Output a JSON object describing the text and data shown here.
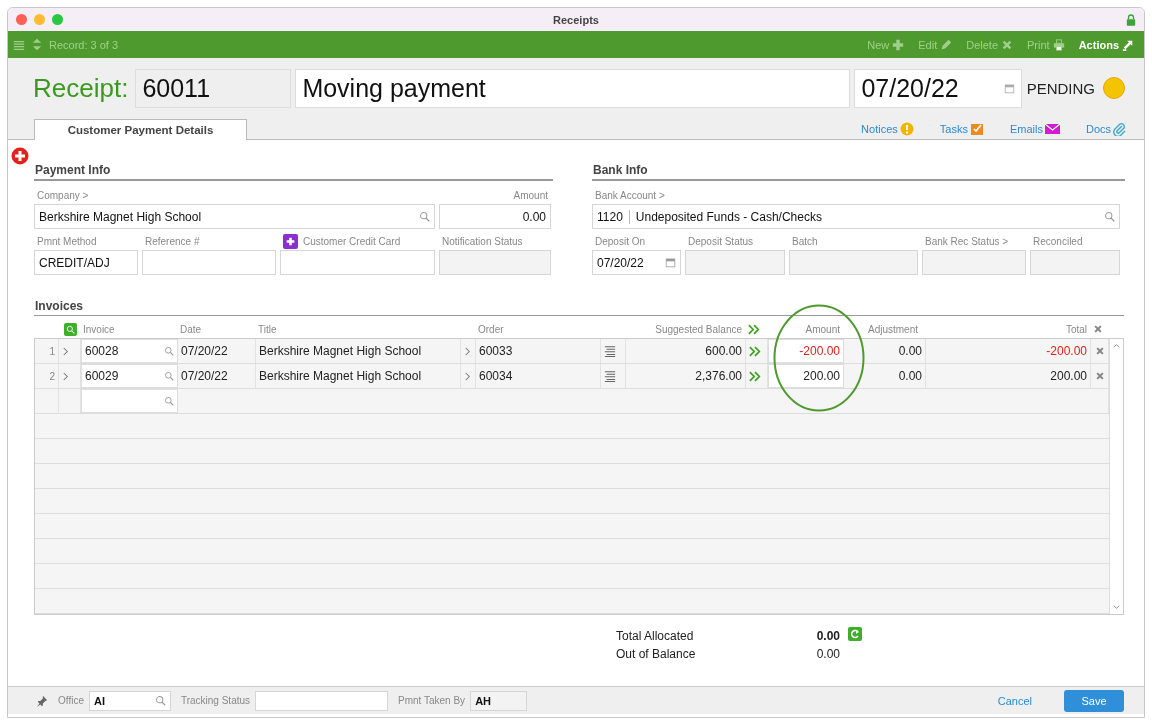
{
  "window": {
    "title": "Receipts"
  },
  "toolbar": {
    "record": "Record: 3 of 3",
    "actions": [
      {
        "label": "New",
        "kind": "new",
        "disabled": true
      },
      {
        "label": "Edit",
        "kind": "edit",
        "disabled": true
      },
      {
        "label": "Delete",
        "kind": "delete",
        "disabled": true
      },
      {
        "label": "Print",
        "kind": "print",
        "disabled": true
      },
      {
        "label": "Actions",
        "kind": "actions",
        "disabled": false
      }
    ]
  },
  "header": {
    "label": "Receipt:",
    "number": "60011",
    "description": "Moving payment",
    "date": "07/20/22",
    "status": "PENDING"
  },
  "tabs": [
    {
      "label": "Customer Payment Details",
      "selected": true
    }
  ],
  "links": [
    {
      "label": "Notices",
      "kind": "notices"
    },
    {
      "label": "Tasks",
      "kind": "tasks"
    },
    {
      "label": "Emails",
      "kind": "emails"
    },
    {
      "label": "Docs",
      "kind": "docs"
    }
  ],
  "sections": [
    {
      "title": "Payment Info",
      "fields": [
        {
          "label": "Company >",
          "value": "Berkshire Magnet High School",
          "kind": "lookup",
          "disabled": false
        },
        {
          "label": "Amount",
          "value": "0.00",
          "kind": "number",
          "disabled": false
        },
        {
          "label": "Pmnt Method",
          "value": "CREDIT/ADJ",
          "kind": "text",
          "disabled": false
        },
        {
          "label": "Reference #",
          "kind": "text",
          "disabled": false
        },
        {
          "label": "Customer Credit Card",
          "kind": "text",
          "add_button": true,
          "disabled": false
        },
        {
          "label": "Notification Status",
          "kind": "text",
          "disabled": true
        }
      ]
    },
    {
      "title": "Bank Info",
      "fields": [
        {
          "label": "Bank Account >",
          "code": "1120",
          "value": "Undeposited Funds - Cash/Checks",
          "kind": "lookup",
          "disabled": false
        },
        {
          "label": "Deposit On",
          "value": "07/20/22",
          "kind": "date",
          "disabled": false
        },
        {
          "label": "Deposit Status",
          "kind": "text",
          "disabled": true
        },
        {
          "label": "Batch",
          "kind": "text",
          "disabled": true
        },
        {
          "label": "Bank Rec Status >",
          "kind": "text",
          "disabled": true
        },
        {
          "label": "Reconciled",
          "kind": "text",
          "disabled": true
        }
      ]
    }
  ],
  "invoices": {
    "title": "Invoices",
    "columns": [
      {
        "label": "Invoice",
        "highlighted": false
      },
      {
        "label": "Date",
        "highlighted": false
      },
      {
        "label": "Title",
        "highlighted": false
      },
      {
        "label": "Order",
        "highlighted": false
      },
      {
        "label": "Suggested Balance",
        "highlighted": false
      },
      {
        "label": "Amount",
        "highlighted": true
      },
      {
        "label": "Adjustment",
        "highlighted": false
      },
      {
        "label": "Total",
        "highlighted": false
      }
    ],
    "rows": [
      {
        "line": "1",
        "invoice": "60028",
        "date": "07/20/22",
        "title": "Berkshire Magnet High School",
        "order": "60033",
        "suggested_balance": "600.00",
        "amount": "-200.00",
        "adjustment": "0.00",
        "total": "-200.00",
        "negative": true
      },
      {
        "line": "2",
        "invoice": "60029",
        "date": "07/20/22",
        "title": "Berkshire Magnet High School",
        "order": "60034",
        "suggested_balance": "2,376.00",
        "amount": "200.00",
        "adjustment": "0.00",
        "total": "200.00",
        "negative": false
      }
    ]
  },
  "totals": [
    {
      "label": "Total Allocated",
      "value": "0.00",
      "kind": "allocated"
    },
    {
      "label": "Out of Balance",
      "value": "0.00",
      "kind": "balance"
    }
  ],
  "footer": {
    "fields": [
      {
        "label": "Office",
        "value": "AI",
        "kind": "lookup",
        "disabled": false
      },
      {
        "label": "Tracking Status",
        "kind": "text",
        "disabled": false
      },
      {
        "label": "Pmnt Taken By",
        "value": "AH",
        "kind": "text",
        "disabled": true
      }
    ],
    "buttons": [
      {
        "label": "Cancel",
        "kind": "link"
      },
      {
        "label": "Save",
        "kind": "primary"
      }
    ]
  }
}
